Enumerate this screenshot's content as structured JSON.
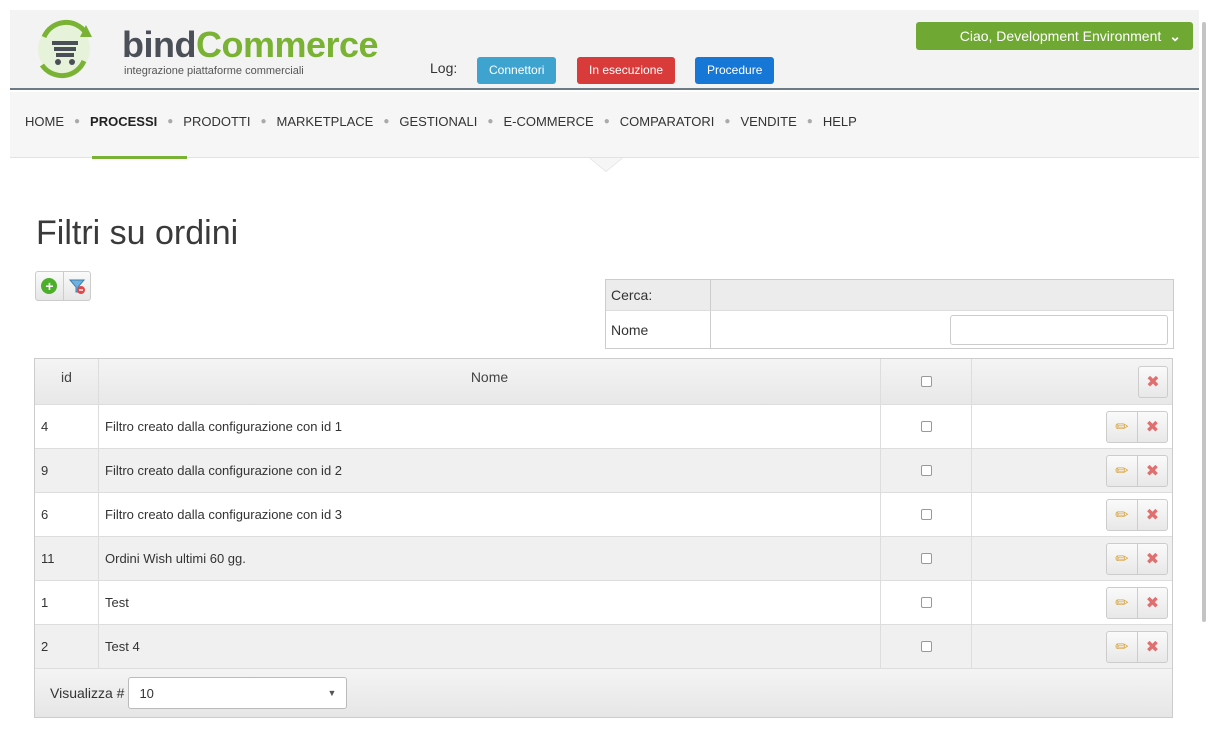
{
  "brand": {
    "name_part1": "bind",
    "name_part2": "Commerce",
    "tagline": "integrazione piattaforme commerciali",
    "accent": "#7ab334"
  },
  "header": {
    "log_label": "Log:",
    "log_buttons": [
      "Connettori",
      "In esecuzione",
      "Procedure"
    ],
    "user_menu": "Ciao, Development Environment"
  },
  "nav": {
    "items": [
      "HOME",
      "PROCESSI",
      "PRODOTTI",
      "MARKETPLACE",
      "GESTIONALI",
      "E-COMMERCE",
      "COMPARATORI",
      "VENDITE",
      "HELP"
    ],
    "active": "PROCESSI"
  },
  "page": {
    "title": "Filtri su ordini"
  },
  "search": {
    "header": "Cerca:",
    "field_label": "Nome",
    "value": ""
  },
  "table": {
    "columns": [
      "id",
      "Nome"
    ],
    "rows": [
      {
        "id": "4",
        "name": "Filtro creato dalla configurazione con id 1"
      },
      {
        "id": "9",
        "name": "Filtro creato dalla configurazione con id 2"
      },
      {
        "id": "6",
        "name": "Filtro creato dalla configurazione con id 3"
      },
      {
        "id": "11",
        "name": "Ordini Wish ultimi 60 gg."
      },
      {
        "id": "1",
        "name": "Test"
      },
      {
        "id": "2",
        "name": "Test 4"
      }
    ]
  },
  "footer": {
    "page_size_label": "Visualizza #",
    "page_size": "10"
  }
}
